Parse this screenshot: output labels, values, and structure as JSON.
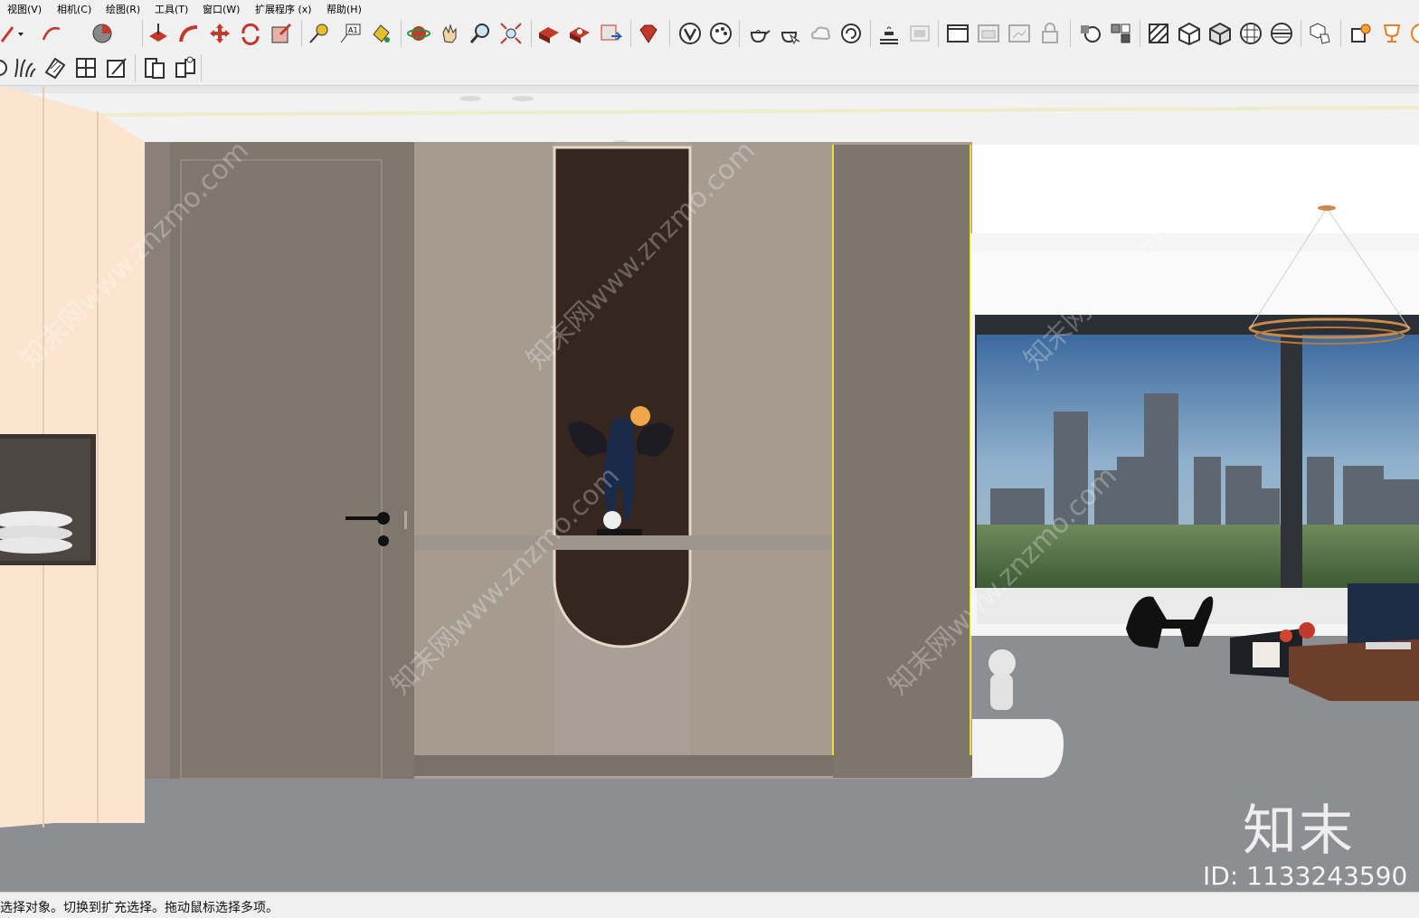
{
  "menu": {
    "items": [
      "视图(V)",
      "相机(C)",
      "绘图(R)",
      "工具(T)",
      "窗口(W)",
      "扩展程序 (x)",
      "帮助(H)"
    ]
  },
  "toolbar_row1": {
    "icons": [
      "pencil-dropdown-icon",
      "arc-dropdown-icon",
      "pie-dropdown-icon",
      "push-pull-icon",
      "follow-me-icon",
      "move-icon",
      "rotate-icon",
      "scale-icon",
      "tape-measure-icon",
      "text-icon",
      "paint-bucket-icon",
      "orbit-icon",
      "pan-icon",
      "zoom-icon",
      "zoom-extents-icon",
      "warehouse-icon",
      "extension-warehouse-icon",
      "send-to-layout-icon",
      "ruby-console-icon",
      "vray-icon",
      "vray-palette-icon",
      "teapot-render-icon",
      "teapot-interactive-icon",
      "cloud-icon",
      "refresh-render-icon",
      "frame-buffer-icon",
      "camera-view-icon",
      "window-icon",
      "window-2-icon",
      "window-3-icon",
      "lock-icon",
      "shape-icon",
      "component-icon",
      "section-plane-icon",
      "cube-iso-icon",
      "cube-top-icon",
      "sphere-icon",
      "sphere-2-icon",
      "hand-cube-icon",
      "settings-icon",
      "trophy-icon",
      "brush-icon"
    ]
  },
  "toolbar_row2": {
    "icons": [
      "shape-partial-icon",
      "grass-icon",
      "plank-icon",
      "grid-icon",
      "slice-icon",
      "door-icon",
      "group-icon"
    ]
  },
  "scene": {
    "description": ""
  },
  "watermark": {
    "brand": "知末",
    "id": "ID: 1133243590",
    "diagonal": "知末网www.znzmo.com"
  },
  "status": {
    "text": "选择对象。切换到扩充选择。拖动鼠标选择多项。"
  }
}
